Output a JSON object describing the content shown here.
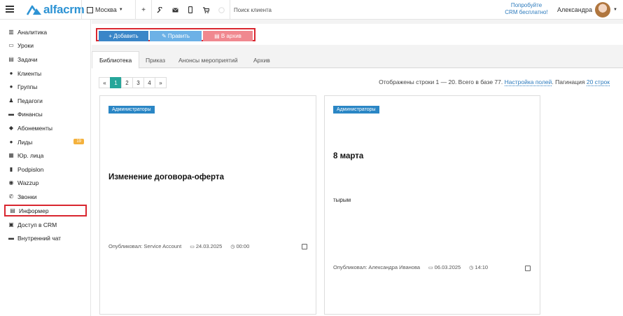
{
  "topbar": {
    "logo_text": "alfacrm",
    "branch_label": "Москва",
    "search_placeholder": "Поиск клиента",
    "promo_line1": "Попробуйте",
    "promo_line2": "CRM бесплатно!",
    "user_name": "Александра"
  },
  "sidebar": {
    "items": [
      {
        "label": "Аналитика",
        "icon": "chart-icon"
      },
      {
        "label": "Уроки",
        "icon": "calendar-icon"
      },
      {
        "label": "Задачи",
        "icon": "clipboard-icon"
      },
      {
        "label": "Клиенты",
        "icon": "user-icon"
      },
      {
        "label": "Группы",
        "icon": "users-icon"
      },
      {
        "label": "Педагоги",
        "icon": "teacher-icon"
      },
      {
        "label": "Финансы",
        "icon": "money-icon"
      },
      {
        "label": "Абонементы",
        "icon": "tag-icon"
      },
      {
        "label": "Лиды",
        "icon": "user-plus-icon",
        "badge": "19"
      },
      {
        "label": "Юр. лица",
        "icon": "building-icon"
      },
      {
        "label": "Podpislon",
        "icon": "file-icon"
      },
      {
        "label": "Wazzup",
        "icon": "whatsapp-icon"
      },
      {
        "label": "Звонки",
        "icon": "phone-icon"
      },
      {
        "label": "Информер",
        "icon": "list-icon",
        "active": true
      },
      {
        "label": "Доступ в CRM",
        "icon": "lock-icon"
      },
      {
        "label": "Внутренний чат",
        "icon": "chat-icon"
      }
    ]
  },
  "toolbar": {
    "add_label": "+ Добавить",
    "edit_label": "✎ Править",
    "archive_label": "▤ В архив"
  },
  "tabs": [
    {
      "label": "Библиотека",
      "active": true
    },
    {
      "label": "Приказ"
    },
    {
      "label": "Анонсы мероприятий"
    },
    {
      "label": "Архив"
    }
  ],
  "pager": {
    "items": [
      "«",
      "1",
      "2",
      "3",
      "4",
      "»"
    ],
    "active": "1"
  },
  "row_info": {
    "text": "Отображены строки 1 — 20. Всего в базе 77.",
    "fields_link": "Настройка полей",
    "pagination_label": "Пагинация",
    "pagination_value": "20 строк"
  },
  "cards": [
    {
      "badge": "Администраторы",
      "title": "Изменение договора-оферта",
      "body": "",
      "author": "Опубликовал: Service Account",
      "date": "24.03.2025",
      "time": "00:00"
    },
    {
      "badge": "Администраторы",
      "title": "8 марта",
      "body": "тырым",
      "author": "Опубликовал: Александра Иванова",
      "date": "06.03.2025",
      "time": "14:10"
    }
  ],
  "colors": {
    "accent": "#2d93d4",
    "add": "#3a86c8",
    "edit": "#6cb1e6",
    "archive": "#f0888f",
    "highlight": "#d9262f",
    "pager_active": "#26a69a",
    "badge": "#f4b13c"
  }
}
